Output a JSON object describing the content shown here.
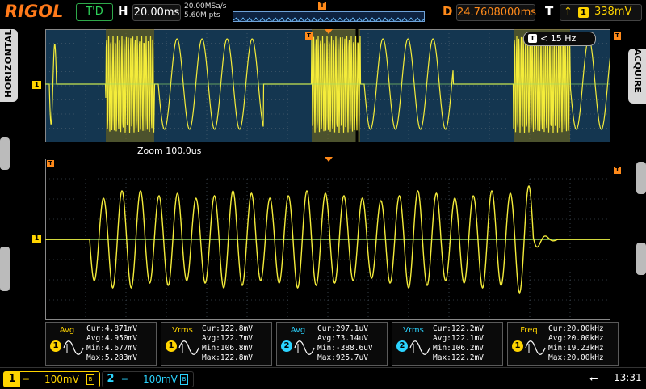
{
  "header": {
    "logo": "RIGOL",
    "run_status": "T'D",
    "timebase_label": "H",
    "timebase_value": "20.00ms",
    "sample_rate": "20.00MSa/s",
    "memory_depth": "5.60M pts",
    "delay_label": "D",
    "delay_value": "24.7608000ms",
    "trigger_label": "T",
    "trigger_source": "1",
    "trigger_level": "338mV"
  },
  "side_tabs": {
    "left": "HORIZONTAL",
    "right": "ACQUIRE"
  },
  "overview": {
    "trigger_hint": "< 15 Hz",
    "zoom_label": "Zoom  100.0us"
  },
  "measurements": [
    {
      "name": "Avg",
      "source": "1",
      "color": "#ffd400",
      "cur": "Cur:4.871mV",
      "avg": "Avg:4.950mV",
      "min": "Min:4.677mV",
      "max": "Max:5.283mV"
    },
    {
      "name": "Vrms",
      "source": "1",
      "color": "#ffd400",
      "cur": "Cur:122.8mV",
      "avg": "Avg:122.7mV",
      "min": "Min:106.8mV",
      "max": "Max:122.8mV"
    },
    {
      "name": "Avg",
      "source": "2",
      "color": "#2bd4ff",
      "cur": "Cur:297.1uV",
      "avg": "Avg:73.14uV",
      "min": "Min:-388.6uV",
      "max": "Max:925.7uV"
    },
    {
      "name": "Vrms",
      "source": "2",
      "color": "#2bd4ff",
      "cur": "Cur:122.2mV",
      "avg": "Avg:122.1mV",
      "min": "Min:106.2mV",
      "max": "Max:122.2mV"
    },
    {
      "name": "Freq",
      "source": "1",
      "color": "#ffd400",
      "cur": "Cur:20.00kHz",
      "avg": "Avg:20.00kHz",
      "min": "Min:19.23kHz",
      "max": "Max:20.00kHz"
    }
  ],
  "channels": [
    {
      "num": "1",
      "coupling": "═",
      "scale": "100mV",
      "color": "#ffd400"
    },
    {
      "num": "2",
      "coupling": "═",
      "scale": "100mV",
      "color": "#2bd4ff"
    }
  ],
  "status": {
    "clock": "13:31"
  },
  "colors": {
    "ch1": "#ffd400",
    "ch2": "#2bd4ff",
    "trigger": "#ff8a1a",
    "run": "#2ed35a"
  }
}
